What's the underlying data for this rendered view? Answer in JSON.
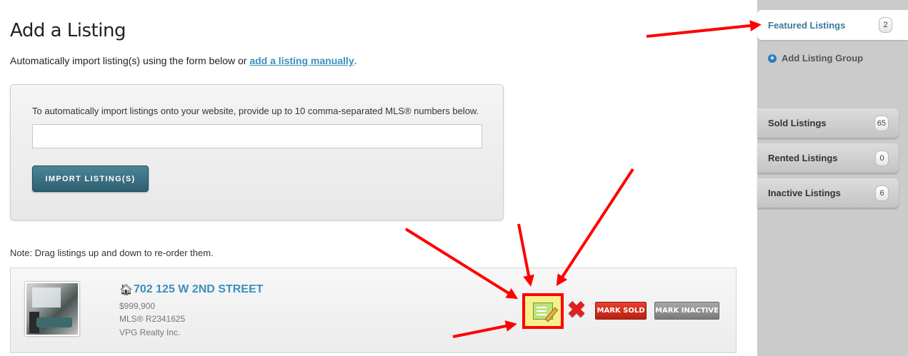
{
  "page": {
    "title": "Add a Listing",
    "intro_text": "Automatically import listing(s) using the form below or ",
    "intro_link": "add a listing manually",
    "intro_end": "."
  },
  "import": {
    "instructions": "To automatically import listings onto your website, provide up to 10 comma-separated MLS® numbers below.",
    "input_value": "",
    "button_label": "IMPORT LISTING(S)"
  },
  "note": "Note: Drag listings up and down to re-order them.",
  "listing": {
    "address": "702 125 W 2ND STREET",
    "price": "$999,900",
    "mls": "MLS® R2341625",
    "brokerage": "VPG Realty Inc.",
    "mark_sold_label": "MARK SOLD",
    "mark_inactive_label": "MARK INACTIVE",
    "edit_icon": "edit-notepad-icon",
    "delete_icon": "close-x-icon"
  },
  "sidebar": {
    "featured": {
      "label": "Featured Listings",
      "count": "2"
    },
    "add_group": "Add Listing Group",
    "items": [
      {
        "label": "Sold Listings",
        "count": "65"
      },
      {
        "label": "Rented Listings",
        "count": "0"
      },
      {
        "label": "Inactive Listings",
        "count": "6"
      }
    ]
  },
  "colors": {
    "link": "#3a8fbf",
    "import_button": "#2d5f70",
    "mark_sold": "#c8261a",
    "mark_inactive": "#8a8a8a",
    "annotation": "#ff0000",
    "sidebar_bg": "#cbcbcb"
  }
}
